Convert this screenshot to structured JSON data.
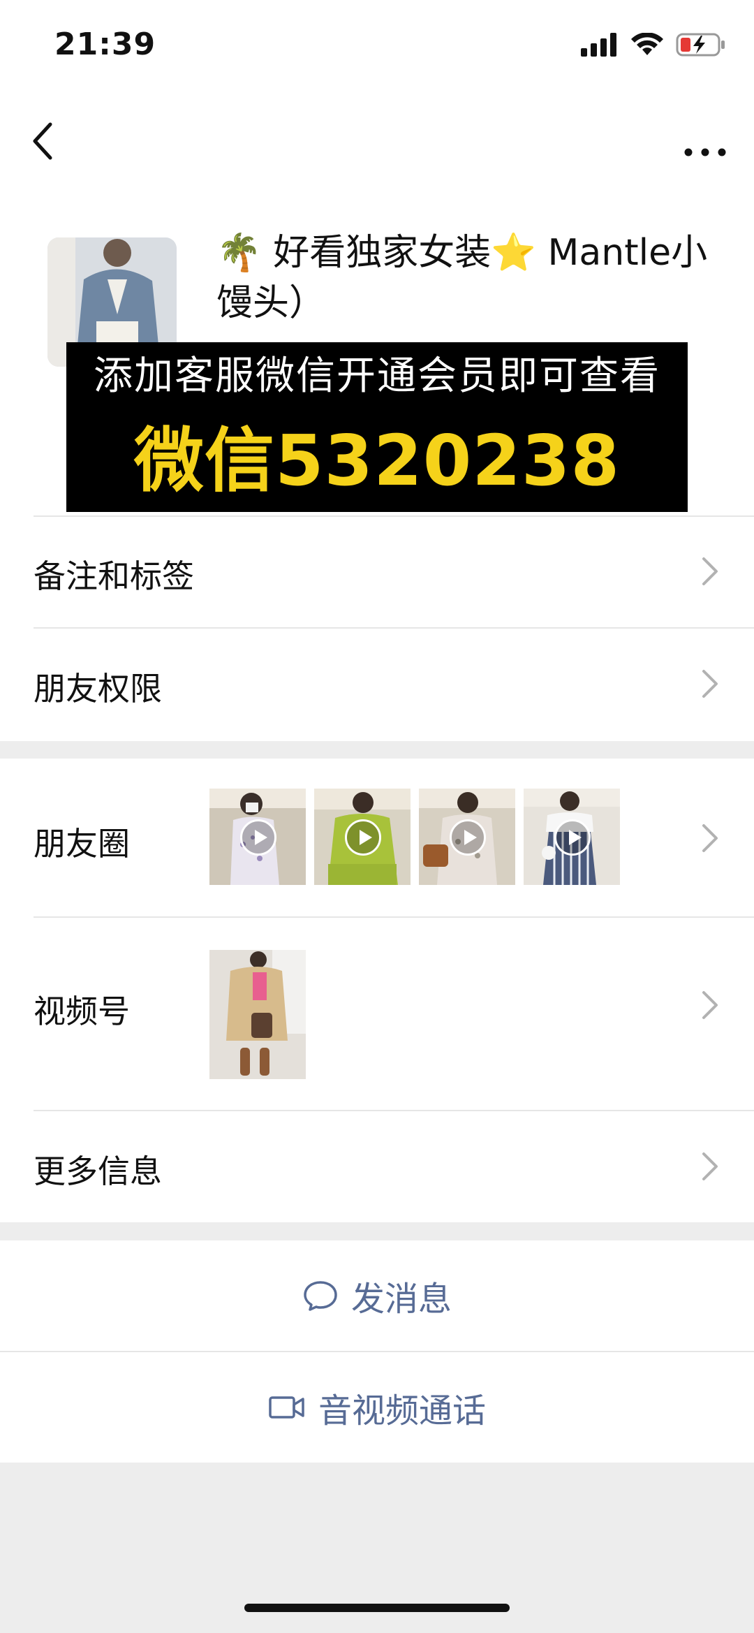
{
  "status_bar": {
    "time": "21:39"
  },
  "profile": {
    "nickname": "🌴 好看独家女装⭐ Mantle小馒头）",
    "promo_line1": "添加客服微信开通会员即可查看",
    "promo_line2": "微信5320238"
  },
  "menu": {
    "remark": "备注和标签",
    "permissions": "朋友权限",
    "moments": "朋友圈",
    "channels": "视频号",
    "more_info": "更多信息"
  },
  "actions": {
    "message": "发消息",
    "call": "音视频通话"
  },
  "colors": {
    "link": "#576b95",
    "promo_yellow": "#f5d21a",
    "background": "#ededed"
  }
}
